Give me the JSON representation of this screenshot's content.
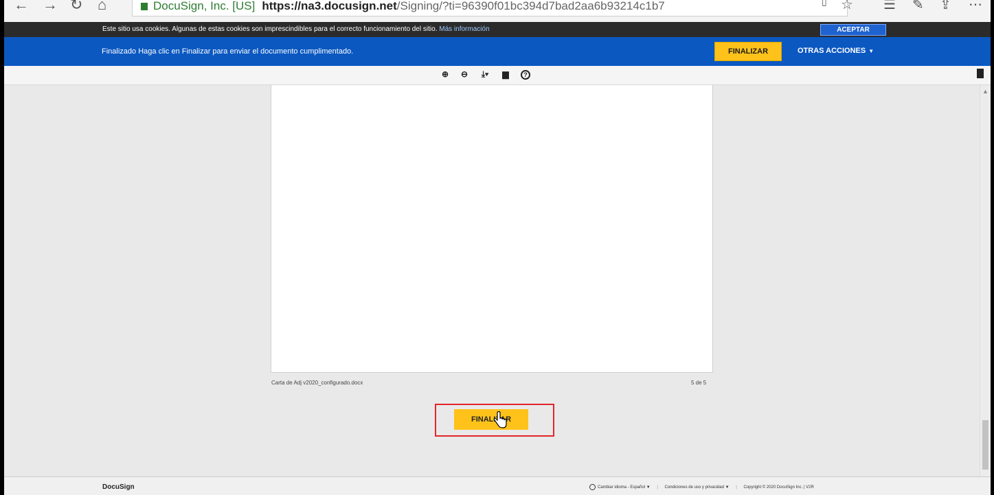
{
  "browser": {
    "site_label": "DocuSign, Inc. [US]",
    "url_host": "https://na3.docusign.net",
    "url_path": "/Signing/?ti=96390f01bc394d7bad2aa6b93214c1b7"
  },
  "cookie_bar": {
    "text": "Este sitio usa cookies. Algunas de estas cookies son imprescindibles para el correcto funcionamiento del sitio.",
    "link": "Más información",
    "accept": "ACEPTAR"
  },
  "action_bar": {
    "message": "Finalizado Haga clic en Finalizar para enviar el documento cumplimentado.",
    "finish": "FINALIZAR",
    "more": "OTRAS ACCIONES",
    "more_caret": "▼"
  },
  "document": {
    "filename": "Carta de Adj v2020_configurado.docx",
    "page_counter": "5 de 5",
    "finish": "FINALIZAR"
  },
  "footer": {
    "brand": "DocuSign",
    "language": "Cambiar idioma - Español ▼",
    "terms": "Condiciones de uso y privacidad ▼",
    "copyright": "Copyright © 2020 DocuSign Inc. | V2R"
  }
}
